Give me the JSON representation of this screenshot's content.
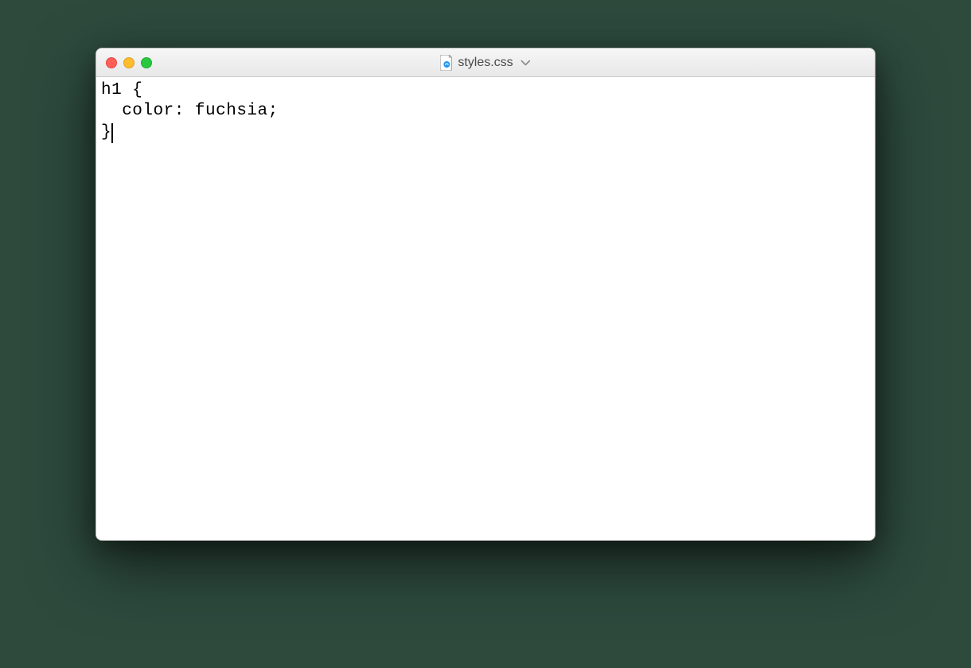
{
  "window": {
    "title": "styles.css",
    "traffic_lights": {
      "close_color": "#ff5f57",
      "minimize_color": "#ffbd2e",
      "maximize_color": "#28c940"
    }
  },
  "editor": {
    "lines": [
      "h1 {",
      "  color: fuchsia;",
      "}"
    ],
    "cursor_line": 2,
    "cursor_col_after_brace": true
  }
}
